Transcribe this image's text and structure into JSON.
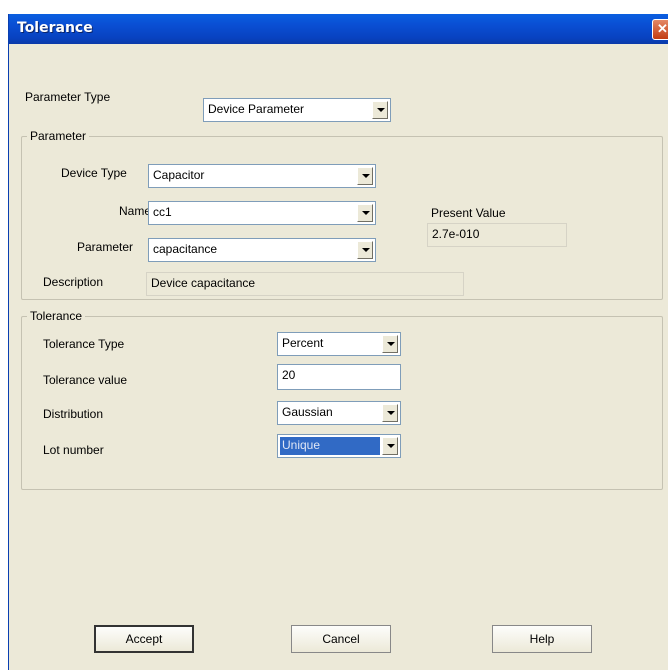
{
  "window": {
    "title": "Tolerance",
    "close": "✕"
  },
  "parameter_type": {
    "label": "Parameter Type",
    "value": "Device Parameter"
  },
  "parameter_group": {
    "title": "Parameter",
    "device_type": {
      "label": "Device Type",
      "value": "Capacitor"
    },
    "name": {
      "label": "Name",
      "value": "cc1"
    },
    "parameter": {
      "label": "Parameter",
      "value": "capacitance"
    },
    "present_value": {
      "label": "Present Value",
      "value": "2.7e-010"
    },
    "description": {
      "label": "Description",
      "value": "Device capacitance"
    }
  },
  "tolerance_group": {
    "title": "Tolerance",
    "tolerance_type": {
      "label": "Tolerance Type",
      "value": "Percent"
    },
    "tolerance_value": {
      "label": "Tolerance value",
      "value": "20"
    },
    "distribution": {
      "label": "Distribution",
      "value": "Gaussian"
    },
    "lot_number": {
      "label": "Lot number",
      "value": "Unique"
    }
  },
  "buttons": {
    "accept": "Accept",
    "cancel": "Cancel",
    "help": "Help"
  }
}
